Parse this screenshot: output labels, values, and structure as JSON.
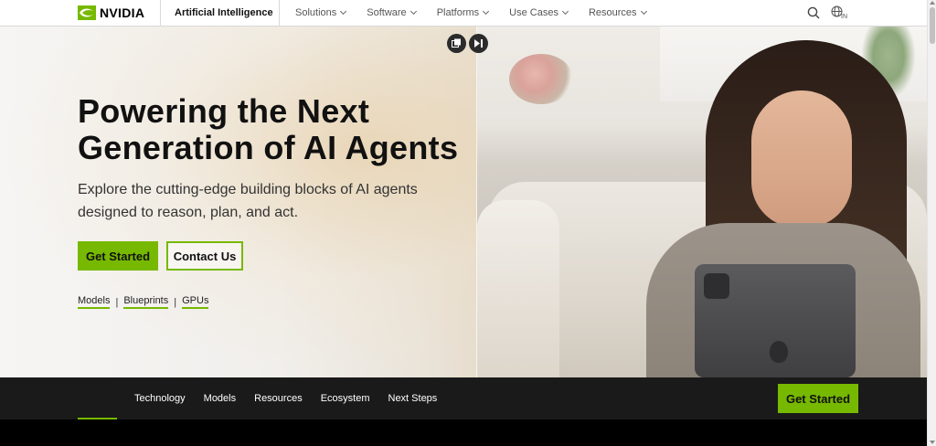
{
  "header": {
    "brand": "NVIDIA",
    "section_title": "Artificial Intelligence",
    "menu": [
      {
        "label": "Solutions"
      },
      {
        "label": "Software"
      },
      {
        "label": "Platforms"
      },
      {
        "label": "Use Cases"
      },
      {
        "label": "Resources"
      }
    ],
    "region_label": "IN",
    "icons": [
      "search-icon",
      "globe-icon"
    ]
  },
  "hero": {
    "title": "Powering the Next Generation of AI Agents",
    "subtitle": "Explore the cutting-edge building blocks of AI agents designed to reason, plan, and act.",
    "primary_button": "Get Started",
    "secondary_button": "Contact Us",
    "quick_links": [
      "Models",
      "Blueprints",
      "GPUs"
    ],
    "separator": "|",
    "media_icons": [
      "picture-in-picture-icon",
      "skip-icon"
    ]
  },
  "subnav": {
    "items": [
      "Technology",
      "Models",
      "Resources",
      "Ecosystem",
      "Next Steps"
    ],
    "button": "Get Started"
  },
  "colors": {
    "accent": "#76b900",
    "subnav_bg": "#1a1a1a",
    "text_dark": "#111111"
  }
}
